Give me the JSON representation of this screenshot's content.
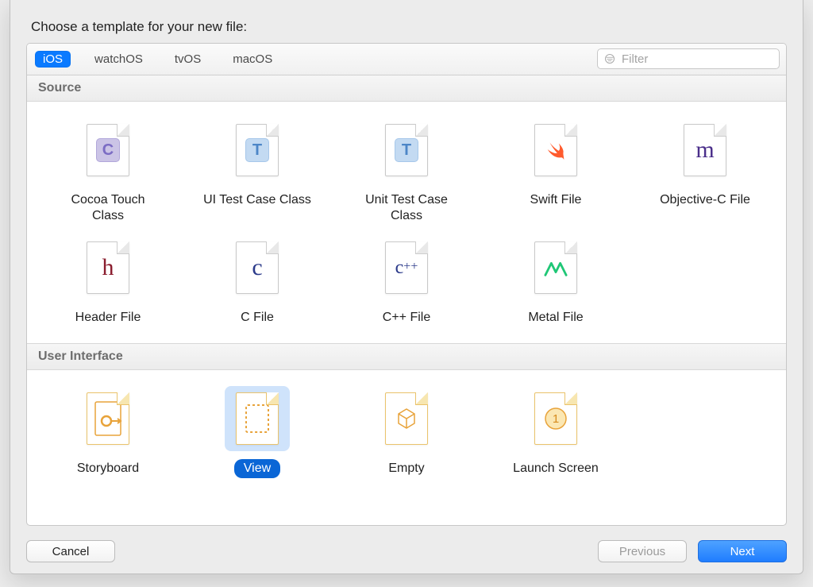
{
  "title": "Choose a template for your new file:",
  "tabs": [
    "iOS",
    "watchOS",
    "tvOS",
    "macOS"
  ],
  "active_tab": 0,
  "filter": {
    "placeholder": "Filter",
    "value": ""
  },
  "sections": [
    {
      "name": "Source",
      "items": [
        {
          "label": "Cocoa Touch Class",
          "icon": "cocoa"
        },
        {
          "label": "UI Test Case Class",
          "icon": "tcase"
        },
        {
          "label": "Unit Test Case Class",
          "icon": "tcase"
        },
        {
          "label": "Swift File",
          "icon": "swift"
        },
        {
          "label": "Objective-C File",
          "icon": "m"
        },
        {
          "label": "Header File",
          "icon": "h"
        },
        {
          "label": "C File",
          "icon": "c"
        },
        {
          "label": "C++ File",
          "icon": "cpp"
        },
        {
          "label": "Metal File",
          "icon": "metal"
        }
      ]
    },
    {
      "name": "User Interface",
      "items": [
        {
          "label": "Storyboard",
          "icon": "storyboard"
        },
        {
          "label": "View",
          "icon": "view",
          "selected": true
        },
        {
          "label": "Empty",
          "icon": "empty"
        },
        {
          "label": "Launch Screen",
          "icon": "launch"
        }
      ]
    }
  ],
  "buttons": {
    "cancel": "Cancel",
    "previous": "Previous",
    "next": "Next"
  },
  "previous_enabled": false
}
